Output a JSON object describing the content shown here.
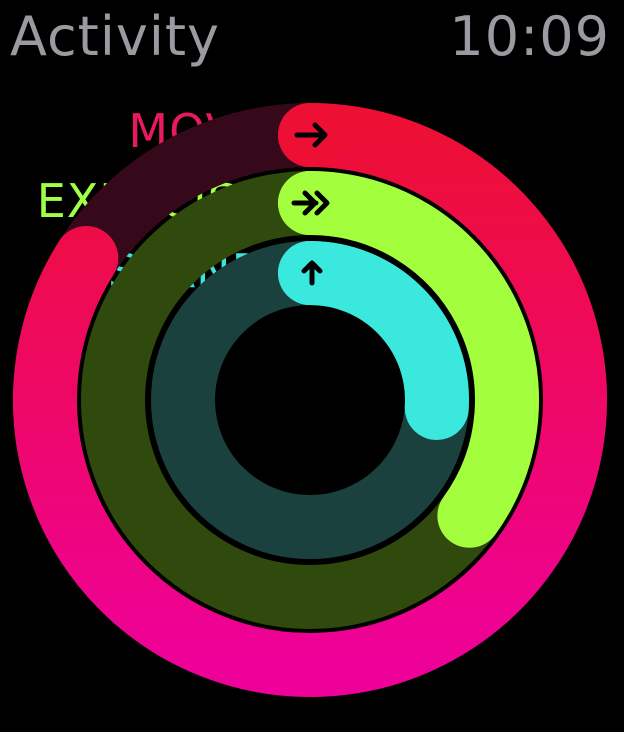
{
  "header": {
    "title": "Activity",
    "time": "10:09"
  },
  "rings": [
    {
      "id": "move",
      "label": "MOVE",
      "color": "#e8195f",
      "track_color": "#35091a",
      "gradient_start": "#ee0f35",
      "gradient_end": "#ee0199",
      "icon": "arrow-right-icon",
      "progress": 0.84
    },
    {
      "id": "exercise",
      "label": "EXERCISE",
      "color": "#a1ff45",
      "track_color": "#2f4a0c",
      "gradient_start": "#a3ff3d",
      "gradient_end": "#a3ff3d",
      "icon": "double-arrow-right-icon",
      "progress": 0.35
    },
    {
      "id": "stand",
      "label": "STAND",
      "color": "#3fe2db",
      "track_color": "#1b413f",
      "gradient_start": "#3ae8de",
      "gradient_end": "#3ae8de",
      "icon": "arrow-up-icon",
      "progress": 0.26
    }
  ]
}
